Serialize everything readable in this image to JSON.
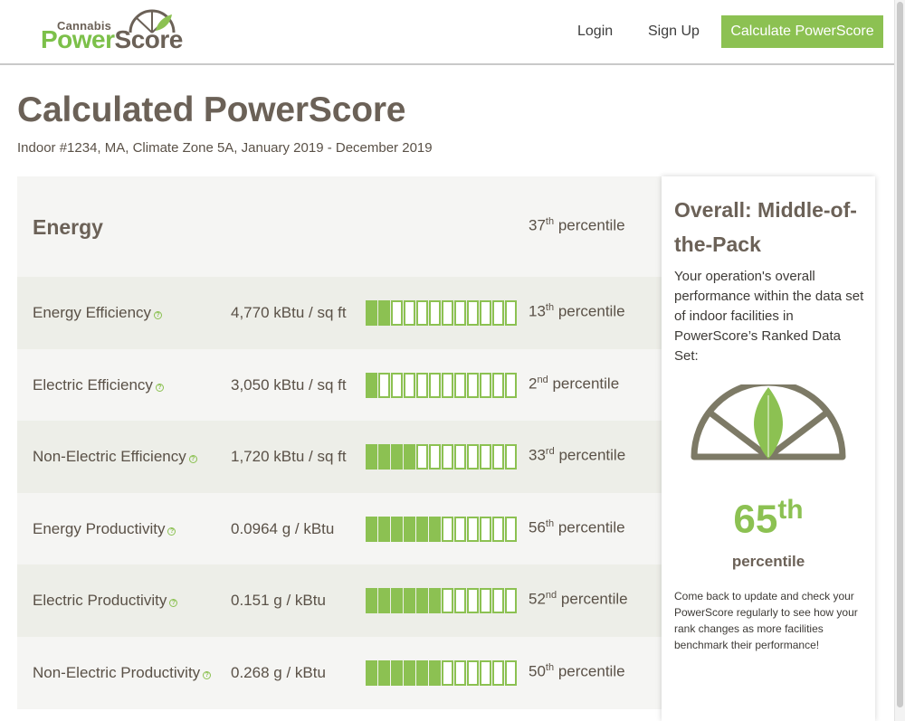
{
  "header": {
    "logo_small": "Cannabis",
    "logo_power": "Power",
    "logo_score": "Score",
    "login": "Login",
    "signup": "Sign Up",
    "cta": "Calculate PowerScore"
  },
  "page": {
    "title": "Calculated PowerScore",
    "subtitle": "Indoor #1234, MA, Climate Zone 5A, January 2019 - December 2019"
  },
  "energy": {
    "title": "Energy",
    "percentile_num": "37",
    "percentile_suffix": "th",
    "percentile_word": "percentile"
  },
  "metrics": [
    {
      "label": "Energy Efficiency",
      "value": "4,770 kBtu / sq ft",
      "num": "13",
      "suffix": "th",
      "word": "percentile",
      "bars_filled": 2
    },
    {
      "label": "Electric Efficiency",
      "value": "3,050 kBtu / sq ft",
      "num": "2",
      "suffix": "nd",
      "word": "percentile",
      "bars_filled": 1
    },
    {
      "label": "Non-Electric Efficiency",
      "value": "1,720 kBtu / sq ft",
      "num": "33",
      "suffix": "rd",
      "word": "percentile",
      "bars_filled": 4
    },
    {
      "label": "Energy Productivity",
      "value": "0.0964 g / kBtu",
      "num": "56",
      "suffix": "th",
      "word": "percentile",
      "bars_filled": 6
    },
    {
      "label": "Electric Productivity",
      "value": "0.151 g / kBtu",
      "num": "52",
      "suffix": "nd",
      "word": "percentile",
      "bars_filled": 6
    },
    {
      "label": "Non-Electric Productivity",
      "value": "0.268 g / kBtu",
      "num": "50",
      "suffix": "th",
      "word": "percentile",
      "bars_filled": 6
    }
  ],
  "meter_total_cells": 12,
  "overall": {
    "title": "Overall: Middle-of-the-Pack",
    "description": "Your operation's overall performance within the data set of indoor facilities in PowerScore’s Ranked Data Set:",
    "score_num": "65",
    "score_suffix": "th",
    "score_label": "percentile",
    "footer": "Come back to update and check your PowerScore regularly to see how your rank changes as more facilities benchmark their performance!"
  },
  "colors": {
    "brand_green": "#8cc152",
    "brand_brown": "#6b6157",
    "gauge_gray": "#7d7a66"
  },
  "icons": {
    "help": "question-circle-icon",
    "logo_leaf": "leaf-gauge-icon"
  }
}
